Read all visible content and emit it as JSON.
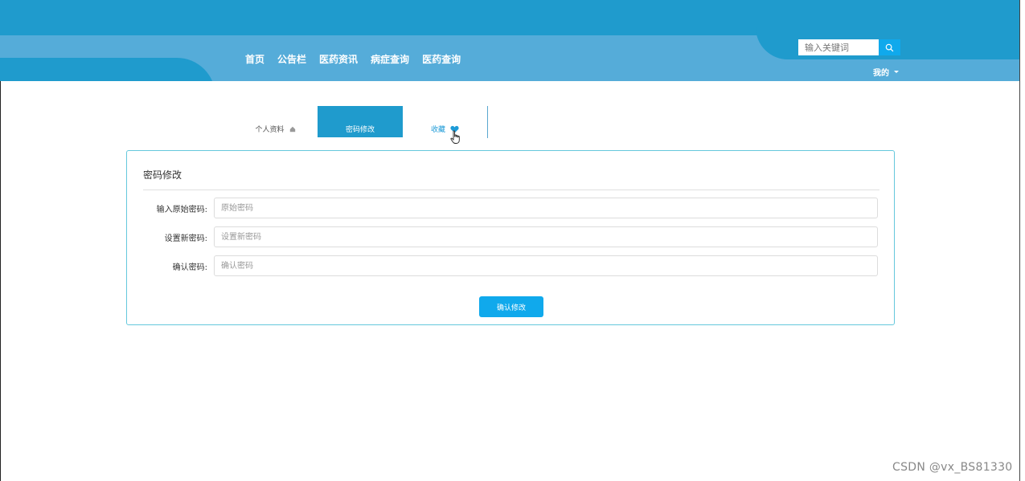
{
  "header": {
    "nav": [
      "首页",
      "公告栏",
      "医药资讯",
      "病症查询",
      "医药查询"
    ],
    "search_placeholder": "输入关键词",
    "user_menu_label": "我的",
    "colors": {
      "header_dark": "#1f9bcd",
      "header_light": "#55acd9",
      "accent": "#10a9ec"
    }
  },
  "tabs": {
    "profile": "个人资料",
    "password": "密码修改",
    "favorites": "收藏",
    "active": "密码修改"
  },
  "panel": {
    "title": "密码修改",
    "fields": [
      {
        "label": "输入原始密码:",
        "placeholder": "原始密码",
        "value": ""
      },
      {
        "label": "设置新密码:",
        "placeholder": "设置新密码",
        "value": ""
      },
      {
        "label": "确认密码:",
        "placeholder": "确认密码",
        "value": ""
      }
    ],
    "submit_label": "确认修改"
  },
  "watermark": "CSDN @vx_BS81330"
}
